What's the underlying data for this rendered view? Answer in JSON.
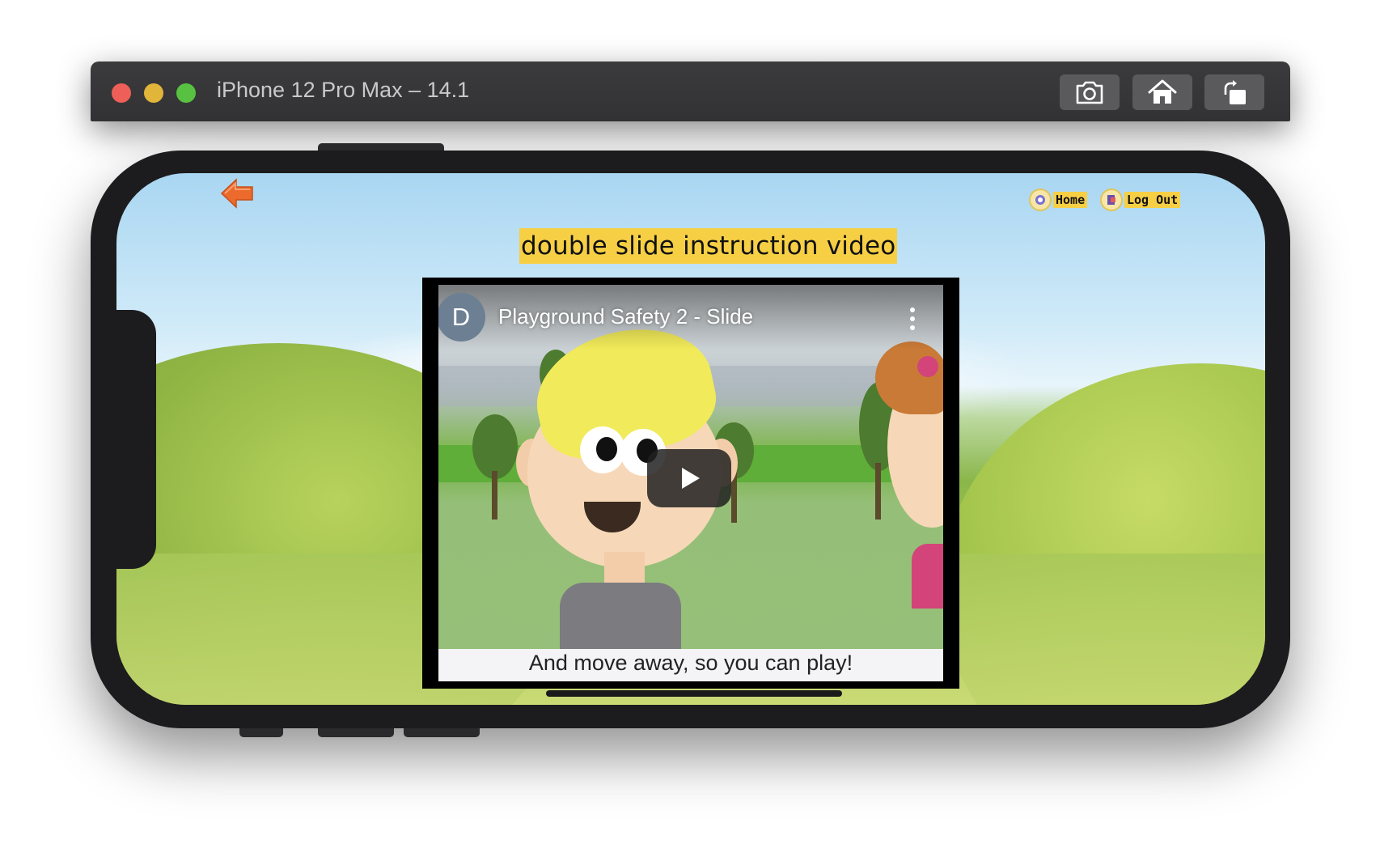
{
  "simulator": {
    "title": "iPhone 12 Pro Max – 14.1",
    "buttons": [
      {
        "name": "screenshot",
        "icon": "camera-icon"
      },
      {
        "name": "home",
        "icon": "home-icon"
      },
      {
        "name": "rotate",
        "icon": "rotate-icon"
      }
    ]
  },
  "app": {
    "back_icon": "back-arrow-icon",
    "nav": {
      "home_label": "Home",
      "logout_label": "Log Out"
    },
    "page_title": "double slide instruction video",
    "video": {
      "channel_initial": "D",
      "title": "Playground Safety 2 - Slide",
      "subtitle": "And move away, so you can play!",
      "play_icon": "play-icon",
      "menu_icon": "more-vertical-icon"
    }
  },
  "colors": {
    "label_background": "#f7cf45",
    "toolbar_background": "#39393b",
    "phone_frame": "#1c1c1e",
    "traffic_red": "#ed5f57",
    "traffic_yellow": "#e1b53a",
    "traffic_green": "#58c141"
  }
}
